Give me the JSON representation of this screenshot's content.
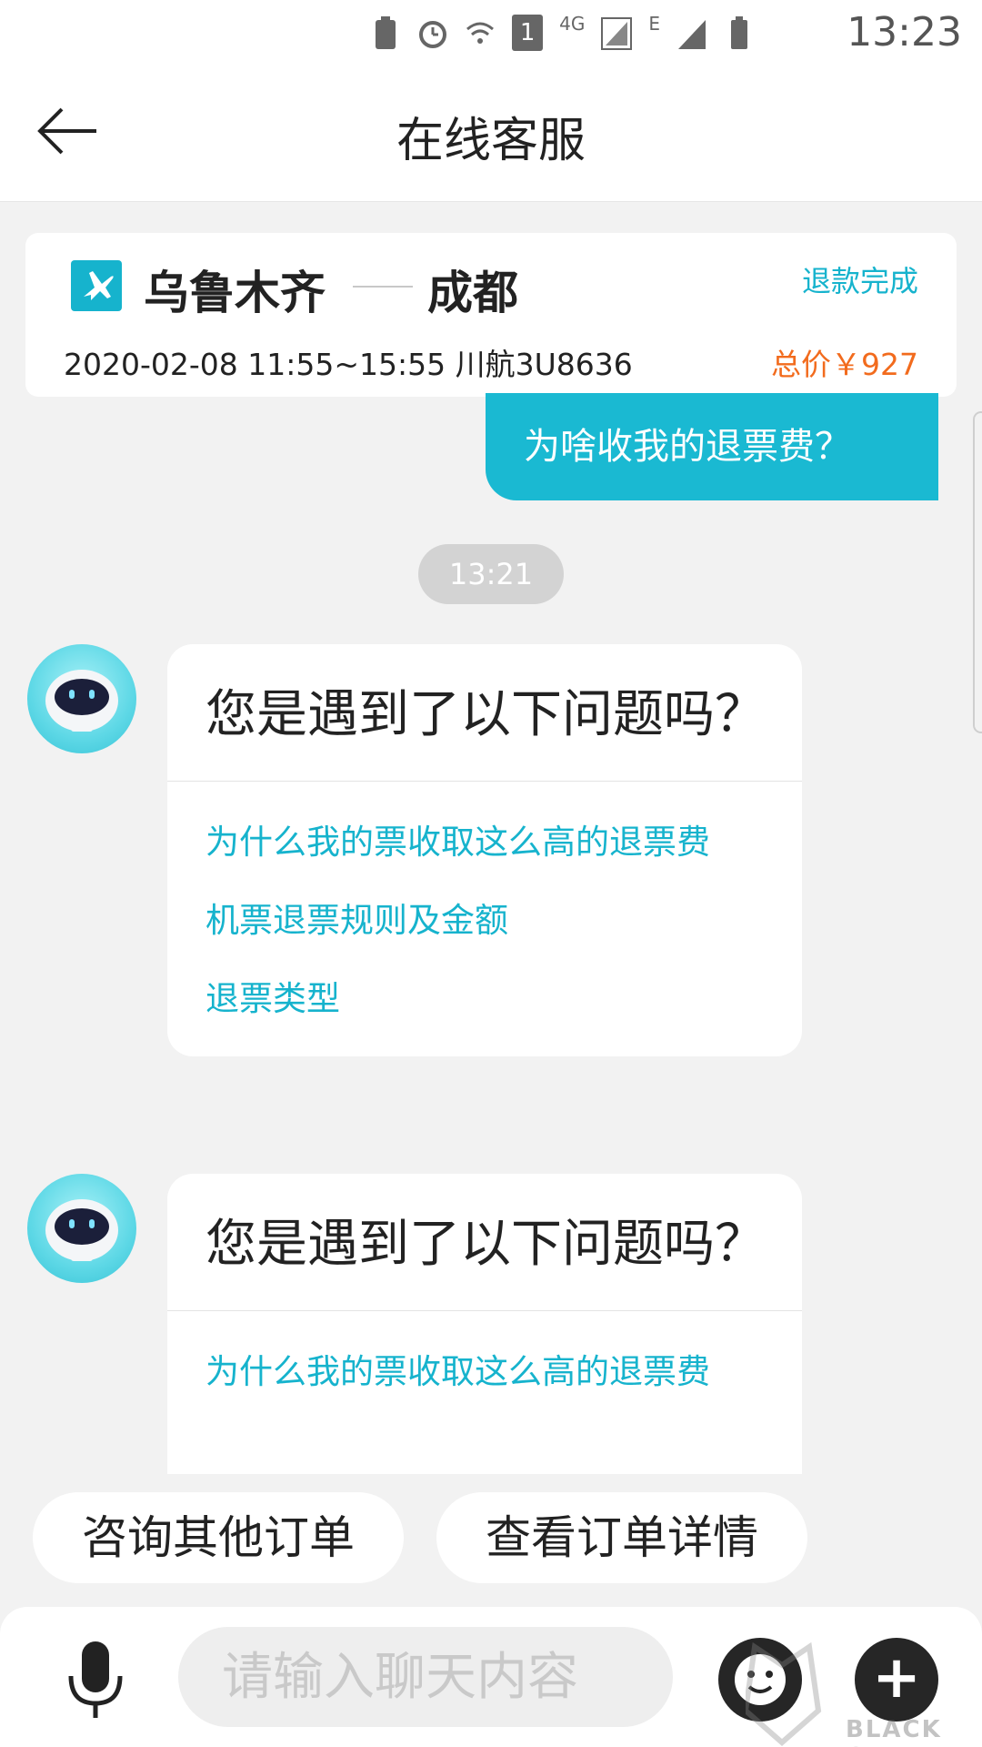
{
  "status_bar": {
    "time": "13:23",
    "sim_slot_badge": "1",
    "network_label_1": "4G",
    "network_label_2": "E"
  },
  "nav": {
    "title": "在线客服",
    "back_icon": "arrow-left-icon"
  },
  "order_card": {
    "from_city": "乌鲁木齐",
    "to_city": "成都",
    "status": "退款完成",
    "flight_info": "2020-02-08 11:55~15:55 川航3U8636",
    "price": "总价￥927",
    "icon": "plane-icon",
    "accent_color": "#16b3cd",
    "price_color": "#f26b1d"
  },
  "chat": {
    "user_message": "为啥收我的退票费？",
    "timestamp": "13:21",
    "bot_messages": [
      {
        "question": "您是遇到了以下问题吗？",
        "options": [
          "为什么我的票收取这么高的退票费",
          "机票退票规则及金额",
          "退票类型"
        ]
      },
      {
        "question": "您是遇到了以下问题吗？",
        "options": [
          "为什么我的票收取这么高的退票费"
        ]
      }
    ]
  },
  "quick_actions": [
    "咨询其他订单",
    "查看订单详情"
  ],
  "input_bar": {
    "placeholder": "请输入聊天内容",
    "mic_icon": "microphone-icon",
    "emoji_icon": "emoji-icon",
    "plus_icon": "plus-icon",
    "plus_label": "+"
  },
  "watermark": {
    "text": "BLACK CAT"
  }
}
